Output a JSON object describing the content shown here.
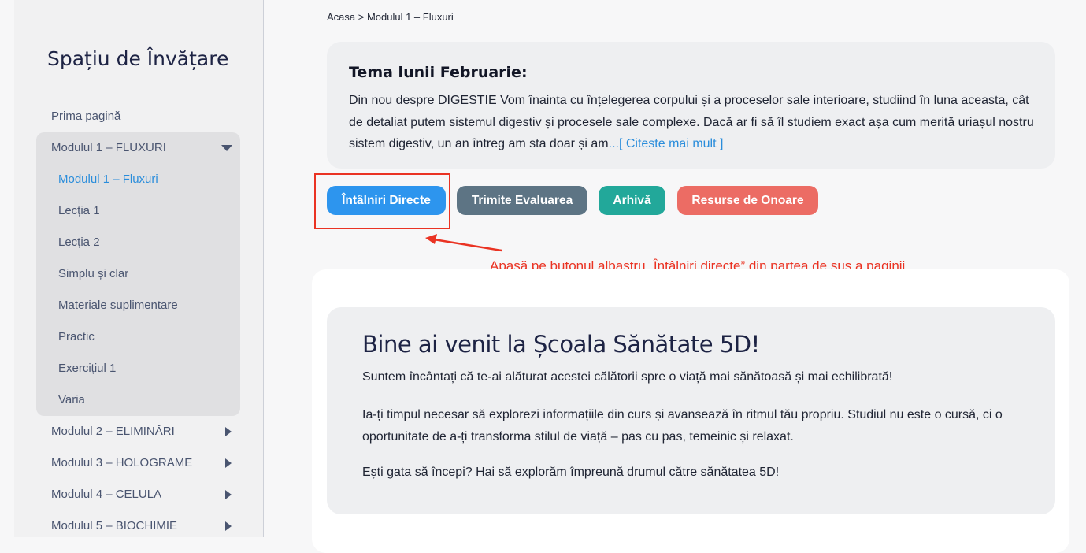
{
  "sidebar": {
    "title": "Spațiu de Învățare",
    "home": "Prima pagină",
    "expanded_module": "Modulul 1 – FLUXURI",
    "sub_items": [
      "Modulul 1 – Fluxuri",
      "Lecția 1",
      "Lecția 2",
      "Simplu și clar",
      "Materiale suplimentare",
      "Practic",
      "Exercițiul 1",
      "Varia"
    ],
    "modules": [
      "Modulul 2 – ELIMINĂRI",
      "Modulul 3 – HOLOGRAME",
      "Modulul 4 – CELULA",
      "Modulul 5 – BIOCHIMIE"
    ]
  },
  "breadcrumb": "Acasa > Modulul 1 – Fluxuri",
  "theme": {
    "title": "Tema lunii Februarie:",
    "text": "Din nou despre DIGESTIE Vom înainta cu înțelegerea corpului și a proceselor sale interioare, studiind în luna aceasta, cât de detaliat putem sistemul digestiv și procesele sale complexe. Dacă ar fi să îl studiem exact așa cum merită uriașul nostru sistem digestiv, un an întreg am sta doar și am",
    "read_more": "...[ Citeste mai mult ]"
  },
  "buttons": {
    "meetings": "Întâlniri Directe",
    "submit": "Trimite Evaluarea",
    "archive": "Arhivă",
    "resources": "Resurse de Onoare"
  },
  "annotation": "Apasă pe butonul albastru „Întâlniri directe” din partea de sus a paginii.",
  "welcome": {
    "title": "Bine ai venit la Școala Sănătate 5D!",
    "p1": "Suntem încântați că te-ai alăturat acestei călătorii spre o viață mai sănătoasă și mai echilibrată!",
    "p2": "Ia-ți timpul necesar să explorezi informațiile din curs și avansează în ritmul tău propriu. Studiul nu este o cursă, ci o oportunitate de a-ți transforma stilul de viață – pas cu pas, temeinic și relaxat.",
    "p3": "Ești gata să începi? Hai să explorăm împreună drumul către sănătatea 5D!"
  },
  "colors": {
    "accent_blue": "#2d95ee",
    "annotation_red": "#ea3323"
  }
}
